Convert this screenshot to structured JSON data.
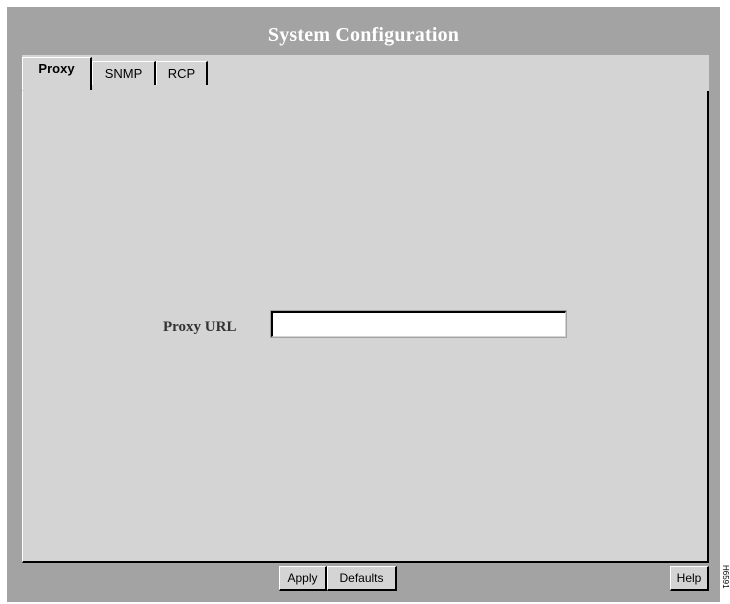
{
  "window": {
    "title": "System Configuration"
  },
  "tabs": [
    {
      "label": "Proxy",
      "active": true
    },
    {
      "label": "SNMP",
      "active": false
    },
    {
      "label": "RCP",
      "active": false
    }
  ],
  "form": {
    "proxy_url_label": "Proxy URL",
    "proxy_url_value": ""
  },
  "buttons": {
    "apply": "Apply",
    "defaults": "Defaults",
    "help": "Help"
  },
  "side_mark": "H6591",
  "colors": {
    "window_bg": "#a3a3a3",
    "panel_bg": "#d4d4d4",
    "title_text": "#ffffff"
  }
}
